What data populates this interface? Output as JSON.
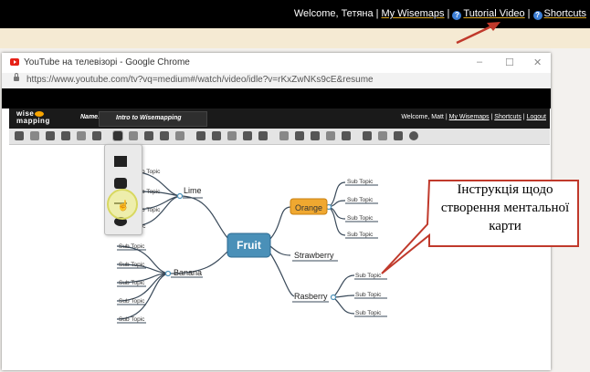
{
  "topbar": {
    "welcome": "Welcome, Тетяна",
    "my_wisemaps": "My Wisemaps",
    "tutorial": "Tutorial Video",
    "shortcuts": "Shortcuts"
  },
  "browser": {
    "title": "YouTube на телевізорі - Google Chrome",
    "url": "https://www.youtube.com/tv?vq=medium#/watch/video/idle?v=rKxZwNKs9cE&resume",
    "minimize": "–",
    "maximize": "☐",
    "close": "✕"
  },
  "wisemapping": {
    "logo_top": "wise",
    "logo_bottom": "mapping",
    "name_label": "Name:",
    "name_value": "Intro to Wisemapping",
    "welcome": "Welcome, Matt",
    "my_wisemaps": "My Wisemaps",
    "shortcuts": "Shortcuts",
    "logout": "Logout",
    "toolbar_icons": [
      "save-icon",
      "print-icon",
      "undo-icon",
      "redo-icon",
      "zoom-in-icon",
      "zoom-out-icon",
      "topic-shape-icon",
      "add-topic-icon",
      "delete-topic-icon",
      "border-color-icon",
      "fill-color-icon",
      "connection-icon",
      "icon-picker-icon",
      "note-icon",
      "link-icon",
      "relationship-icon",
      "font-family-icon",
      "font-size-icon",
      "font-bold-icon",
      "font-italic-icon",
      "font-color-icon",
      "share-icon",
      "publish-icon",
      "export-icon",
      "history-icon"
    ]
  },
  "mindmap": {
    "central": "Fruit",
    "branches": {
      "lime": "Lime",
      "banana": "Banana",
      "orange": "Orange",
      "strawberry": "Strawberry",
      "rasberry": "Rasberry"
    },
    "subtopic": "Sub Topic",
    "colors": {
      "central_fill": "#4a90b8",
      "orange_fill": "#f0a830",
      "line": "#3a4a5a"
    }
  },
  "callout": {
    "text": "Інструкція щодо створення ментальної карти",
    "border_color": "#c0392b"
  }
}
